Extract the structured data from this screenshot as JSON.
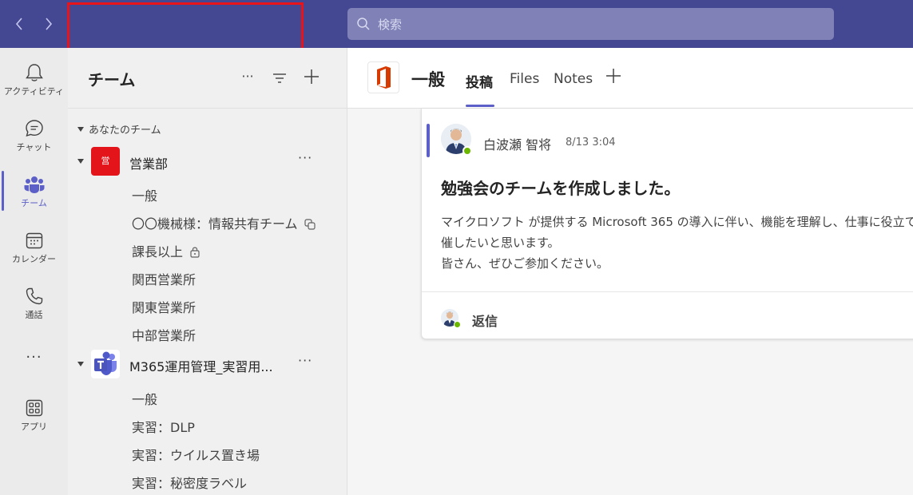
{
  "topbar": {
    "back_icon": "chevron-left-icon",
    "forward_icon": "chevron-right-icon",
    "search_placeholder": "検索",
    "highlight_color": "#e8141a",
    "bg_color": "#444791"
  },
  "rail": {
    "items": [
      {
        "label": "アクティビティ",
        "icon": "bell-icon"
      },
      {
        "label": "チャット",
        "icon": "chat-icon"
      },
      {
        "label": "チーム",
        "icon": "teams-icon",
        "active": true
      },
      {
        "label": "カレンダー",
        "icon": "calendar-icon"
      },
      {
        "label": "通話",
        "icon": "phone-icon"
      },
      {
        "label": "アプリ",
        "icon": "apps-icon"
      }
    ],
    "more": "...",
    "accent_color": "#5b5fc7"
  },
  "teams_panel": {
    "title": "チーム",
    "more": "···",
    "add": "+",
    "section": "あなたのチーム",
    "teams": [
      {
        "name": "営業部",
        "avatar_text": "営",
        "more": "···",
        "channels": [
          "一般",
          "〇〇機械様：情報共有チーム",
          "課長以上",
          "関西営業所",
          "関東営業所",
          "中部営業所"
        ]
      },
      {
        "name": "M365運用管理_実習用...",
        "more": "···",
        "channels": [
          "一般",
          "実習：DLP",
          "実習：ウイルス置き場",
          "実習：秘密度ラベル"
        ]
      }
    ]
  },
  "main": {
    "channel_title": "一般",
    "tabs": [
      "投稿",
      "Files",
      "Notes"
    ],
    "tab_add": "+",
    "post": {
      "author": "白波瀬 智将",
      "time": "8/13 3:04",
      "subject": "勉強会のチームを作成しました。",
      "body_lines": [
        "マイクロソフト が提供する Microsoft 365 の導入に伴い、機能を理解し、仕事に役立て",
        "催したいと思います。",
        "皆さん、ぜひご参加ください。"
      ],
      "reply": "返信"
    }
  }
}
